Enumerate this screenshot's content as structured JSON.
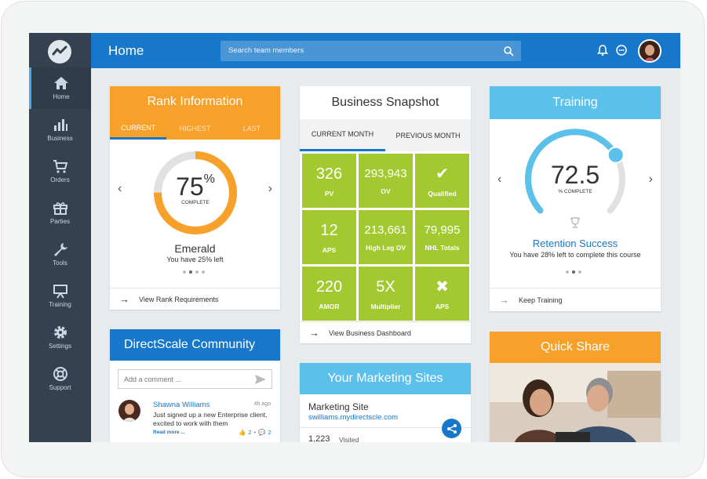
{
  "header": {
    "title": "Home",
    "search_placeholder": "Search team members"
  },
  "sidebar": {
    "items": [
      {
        "label": "Home",
        "icon": "home-icon"
      },
      {
        "label": "Business",
        "icon": "bar-chart-icon"
      },
      {
        "label": "Orders",
        "icon": "cart-icon"
      },
      {
        "label": "Parties",
        "icon": "gift-icon"
      },
      {
        "label": "Tools",
        "icon": "wrench-icon"
      },
      {
        "label": "Training",
        "icon": "presentation-icon"
      },
      {
        "label": "Settings",
        "icon": "gear-icon"
      },
      {
        "label": "Support",
        "icon": "lifebuoy-icon"
      }
    ]
  },
  "rank": {
    "title": "Rank Information",
    "tabs": [
      "CURRENT",
      "HIGHEST",
      "LAST"
    ],
    "percent": "75",
    "percent_sign": "%",
    "complete_label": "COMPLETE",
    "progress": 0.75,
    "rank_name": "Emerald",
    "subtext": "You have 25% left",
    "footer": "View Rank Requirements"
  },
  "snapshot": {
    "title": "Business Snapshot",
    "tabs": [
      "CURRENT MONTH",
      "PREVIOUS MONTH"
    ],
    "cells": [
      {
        "value": "326",
        "label": "PV"
      },
      {
        "value": "293,943",
        "label": "OV"
      },
      {
        "value": "✔",
        "label": "Qualified"
      },
      {
        "value": "12",
        "label": "APS"
      },
      {
        "value": "213,661",
        "label": "High Leg OV"
      },
      {
        "value": "79,995",
        "label": "NHL Totals"
      },
      {
        "value": "220",
        "label": "AMOR"
      },
      {
        "value": "5X",
        "label": "Multiplier"
      },
      {
        "value": "✖",
        "label": "APS"
      }
    ],
    "footer": "View Business Dashboard"
  },
  "training": {
    "title": "Training",
    "score": "72.5",
    "complete_label": "% COMPLETE",
    "progress": 0.725,
    "course_title": "Retention Success",
    "subtext": "You have 28% left to complete this course",
    "footer": "Keep Training"
  },
  "community": {
    "title": "DirectScale Community",
    "comment_placeholder": "Add a comment ...",
    "post": {
      "author": "Shawna Williams",
      "time": "4h ago",
      "text": "Just signed up a new Enterprise client, excited to work with them",
      "read_more": "Read more ...",
      "likes": "2",
      "comments": "2"
    }
  },
  "marketing": {
    "title": "Your Marketing Sites",
    "site_title": "Marketing Site",
    "site_url": "swilliams.mydirectscle.com",
    "visits": "1,223",
    "visits_label": "Visited"
  },
  "quickshare": {
    "title": "Quick Share"
  },
  "colors": {
    "header_blue": "#1777cb",
    "sidebar": "#334150",
    "orange": "#f7a12b",
    "light_blue": "#5cc1ea",
    "green": "#a3c930"
  }
}
